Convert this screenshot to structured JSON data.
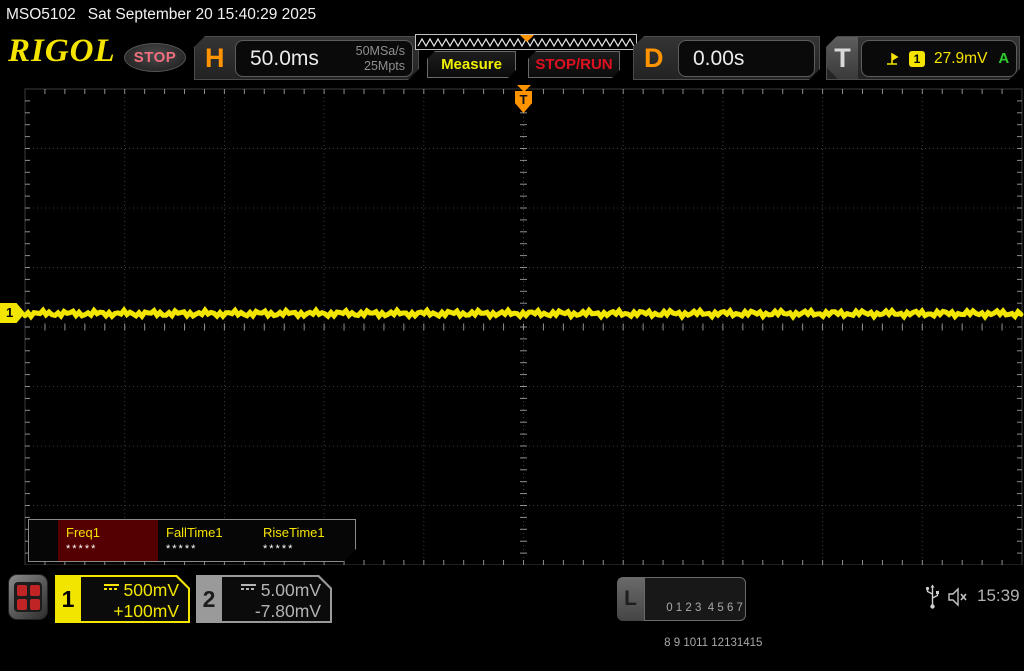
{
  "statusbar": {
    "model": "MSO5102",
    "datetime": "Sat September 20 15:40:29 2025"
  },
  "toolbar": {
    "logo": "RIGOL",
    "run_state": "STOP",
    "horizontal": {
      "label": "H",
      "timebase": "50.0ms",
      "sample_rate": "50MSa/s",
      "memory_depth": "25Mpts"
    },
    "measure_label": "Measure",
    "stop_run_label": "STOP/RUN",
    "delay": {
      "label": "D",
      "value": "0.00s"
    },
    "trigger": {
      "label": "T",
      "source": "1",
      "level": "27.9mV",
      "mode": "A"
    }
  },
  "scope": {
    "ch1_marker": "1",
    "trigger_marker": "T"
  },
  "measurements": [
    {
      "name": "Freq1",
      "value": "*****"
    },
    {
      "name": "FallTime1",
      "value": "*****"
    },
    {
      "name": "RiseTime1",
      "value": "*****"
    }
  ],
  "bottombar": {
    "ch1": {
      "number": "1",
      "scale": "500mV",
      "offset": "+100mV"
    },
    "ch2": {
      "number": "2",
      "scale": "5.00mV",
      "offset": "-7.80mV"
    },
    "digital": {
      "label": "L",
      "row1": "0 1 2 3  4 5 6 7",
      "row2": "8 9 1011 12131415"
    },
    "clock": "15:39"
  },
  "colors": {
    "accent_yellow": "#f2e600",
    "accent_orange": "#ff9400",
    "trigger_green": "#2ecc2e",
    "stop_run_red": "#e01020",
    "stop_pink": "#f26f80"
  }
}
